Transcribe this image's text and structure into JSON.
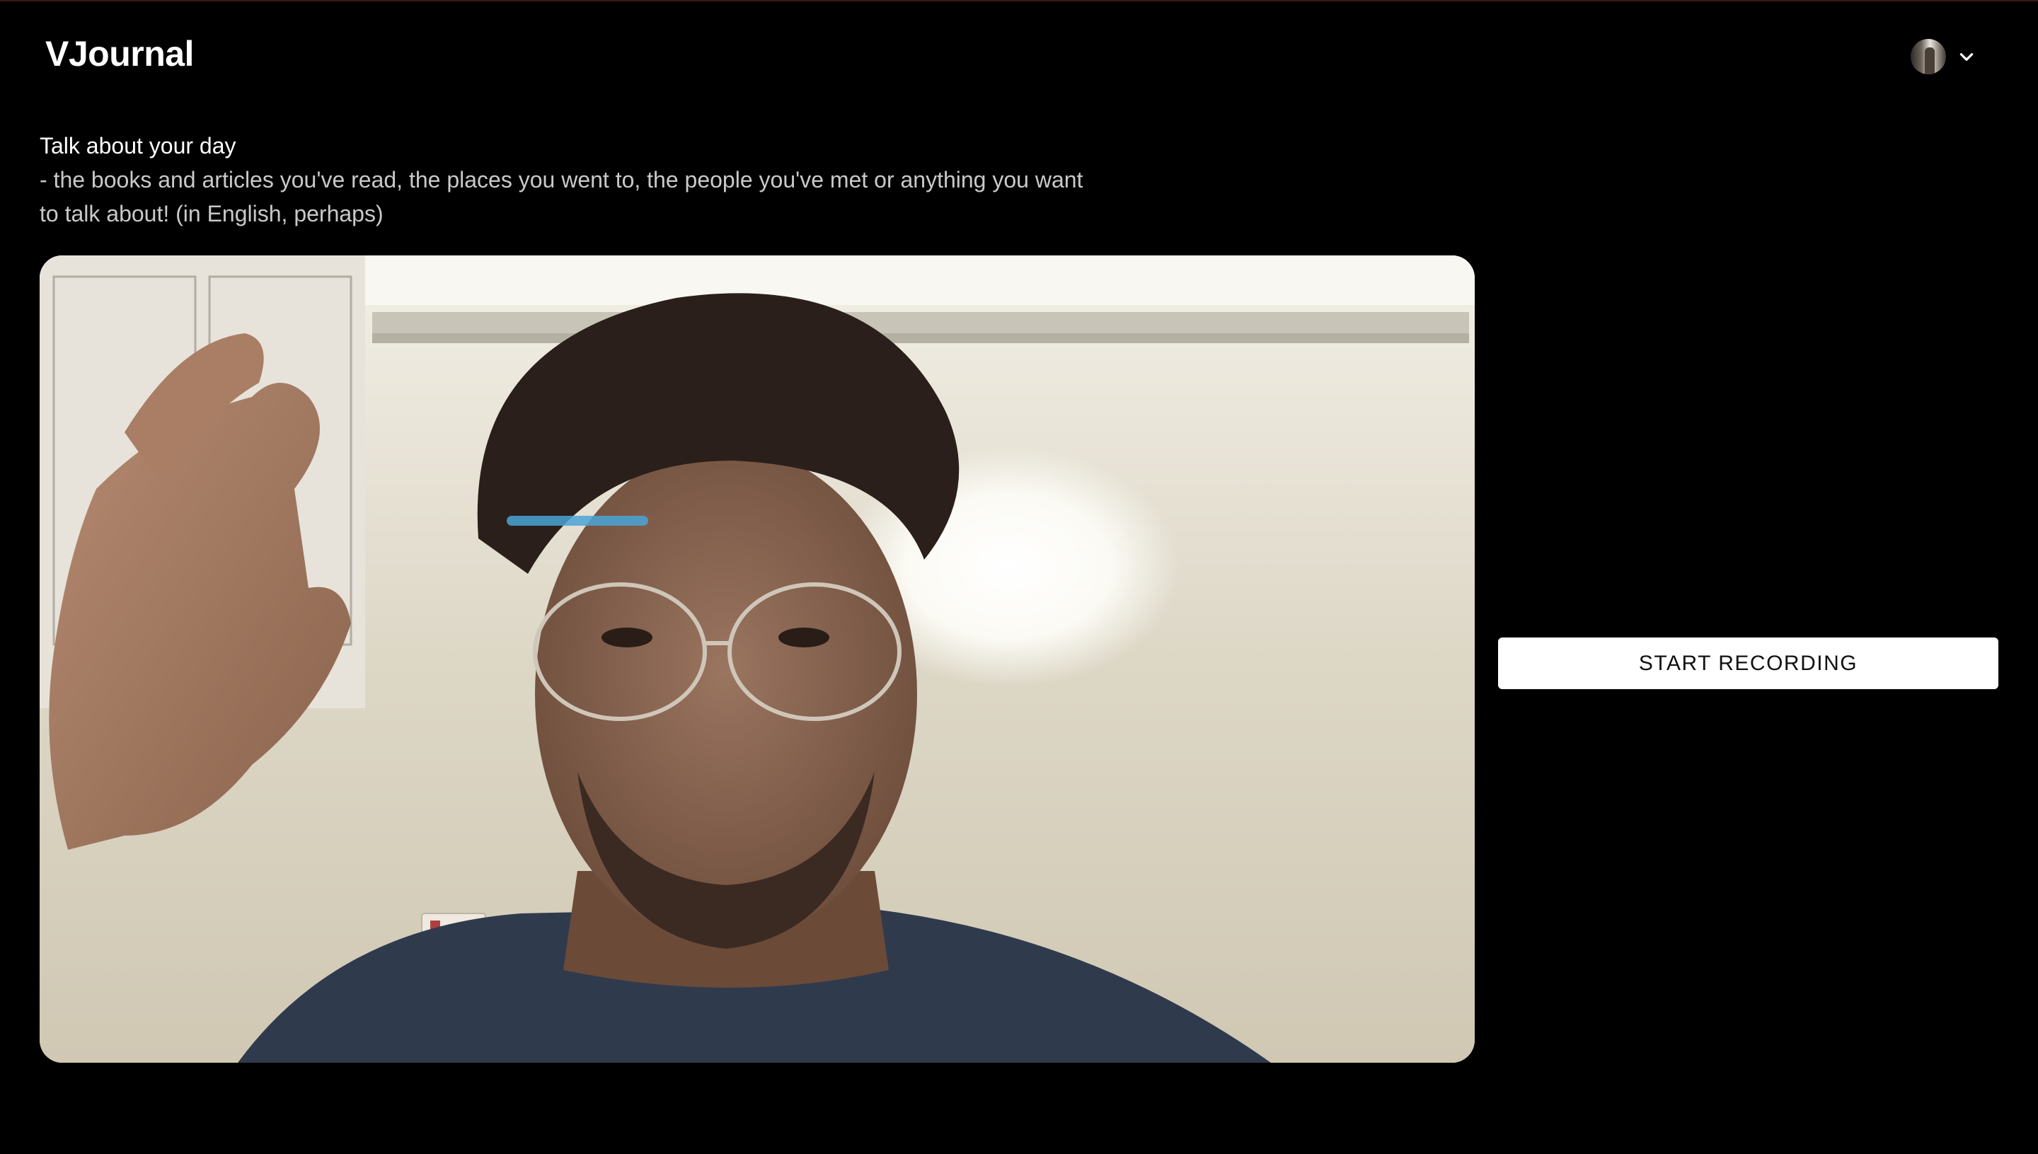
{
  "header": {
    "app_title": "VJournal",
    "avatar_icon": "user-avatar",
    "menu_icon": "chevron-down-icon"
  },
  "prompt": {
    "title": "Talk about your day",
    "body": "- the books and articles you've read, the places you went to, the people you've met or anything you want to talk about! (in English, perhaps)"
  },
  "video": {
    "content": "live-camera-preview"
  },
  "controls": {
    "record_label": "START RECORDING"
  },
  "colors": {
    "background": "#000000",
    "text": "#ffffff",
    "secondary_text": "#c9c9c9",
    "button_bg": "#ffffff",
    "button_text": "#111111"
  }
}
